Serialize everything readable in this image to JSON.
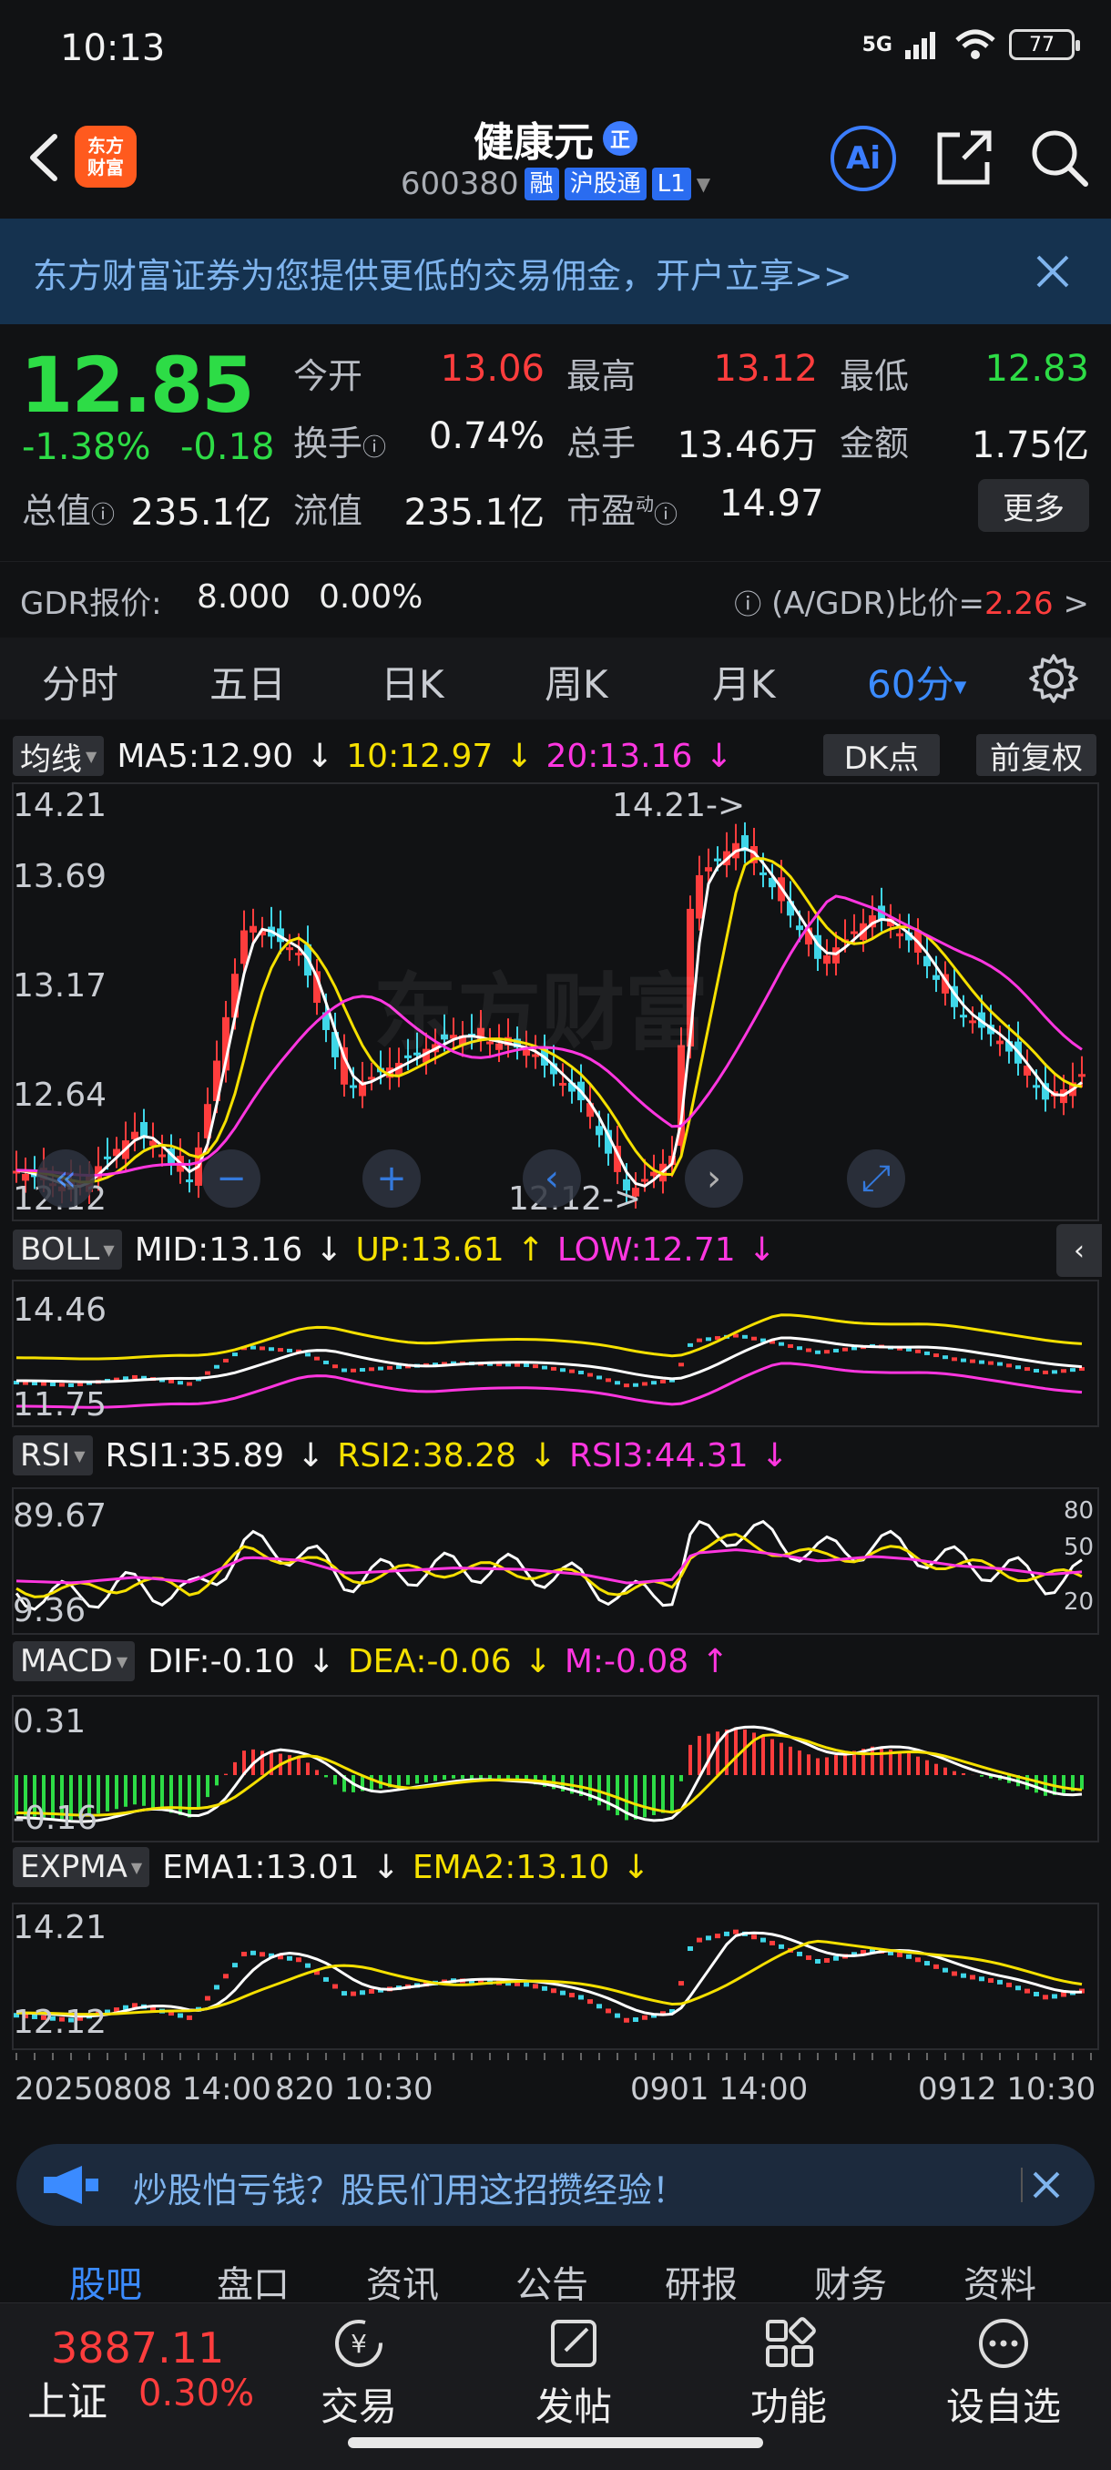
{
  "status_bar": {
    "time": "10:13",
    "network": "5G",
    "battery": "77"
  },
  "header": {
    "stock_name": "健康元",
    "stock_code": "600380",
    "tags": [
      "融",
      "沪股通",
      "L1"
    ],
    "zheng_badge": "正",
    "ai_label": "Ai",
    "logo_text": [
      "东方",
      "财富"
    ]
  },
  "banner": {
    "text": "东方财富证券为您提供更低的交易佣金，开户立享>>"
  },
  "quote": {
    "price": "12.85",
    "change_pct": "-1.38%",
    "change": "-0.18",
    "open_label": "今开",
    "open": "13.06",
    "high_label": "最高",
    "high": "13.12",
    "low_label": "最低",
    "low": "12.83",
    "turnover_label": "换手",
    "turnover": "0.74%",
    "volume_label": "总手",
    "volume": "13.46万",
    "amount_label": "金额",
    "amount": "1.75亿",
    "mktcap_label": "总值",
    "mktcap": "235.1亿",
    "float_label": "流值",
    "float_cap": "235.1亿",
    "pe_label": "市盈",
    "pe_superscript": "动",
    "pe": "14.97",
    "more_label": "更多"
  },
  "gdr": {
    "label": "GDR报价:",
    "price": "8.000",
    "pct": "0.00%",
    "ratio_label": "(A/GDR)比价=",
    "ratio_value": "2.26"
  },
  "period_tabs": [
    "分时",
    "五日",
    "日K",
    "周K",
    "月K",
    "60分"
  ],
  "main_chart": {
    "indicator": "均线",
    "ma5": "MA5:12.90",
    "ma10": "10:12.97",
    "ma20": "20:13.16",
    "dk_label": "DK点",
    "fq_label": "前复权",
    "y_labels": [
      "14.21",
      "13.69",
      "13.17",
      "12.64",
      "12.12"
    ],
    "max_marker": "14.21->",
    "min_marker": "12.12->",
    "watermark": "东方财富"
  },
  "boll": {
    "indicator": "BOLL",
    "mid": "MID:13.16",
    "up": "UP:13.61",
    "low": "LOW:12.71",
    "y_labels": [
      "14.46",
      "11.75"
    ]
  },
  "rsi": {
    "indicator": "RSI",
    "rsi1": "RSI1:35.89",
    "rsi2": "RSI2:38.28",
    "rsi3": "RSI3:44.31",
    "y_labels": [
      "89.67",
      "9.36"
    ],
    "levels": [
      "80",
      "50",
      "20"
    ]
  },
  "macd": {
    "indicator": "MACD",
    "dif": "DIF:-0.10",
    "dea": "DEA:-0.06",
    "m": "M:-0.08",
    "y_labels": [
      "0.31",
      "-0.16"
    ]
  },
  "expma": {
    "indicator": "EXPMA",
    "ema1": "EMA1:13.01",
    "ema2": "EMA2:13.10",
    "y_labels": [
      "14.21",
      "12.12"
    ]
  },
  "date_axis": [
    "20250808 14:00",
    "820 10:30",
    "0901 14:00",
    "0912 10:30"
  ],
  "promo": {
    "text": "炒股怕亏钱？股民们用这招攒经验！"
  },
  "bottom_tabs": [
    "股吧",
    "盘口",
    "资讯",
    "公告",
    "研报",
    "财务",
    "资料"
  ],
  "bottom_bar": {
    "index_value": "3887.11",
    "index_name": "上证",
    "index_pct": "0.30%",
    "nav": [
      "交易",
      "发帖",
      "功能",
      "设自选"
    ]
  },
  "colors": {
    "up": "#ff3d3d",
    "down": "#2ddc46",
    "accent": "#3b8bff",
    "ma10": "#f5e000",
    "ma20": "#ff36e0"
  }
}
